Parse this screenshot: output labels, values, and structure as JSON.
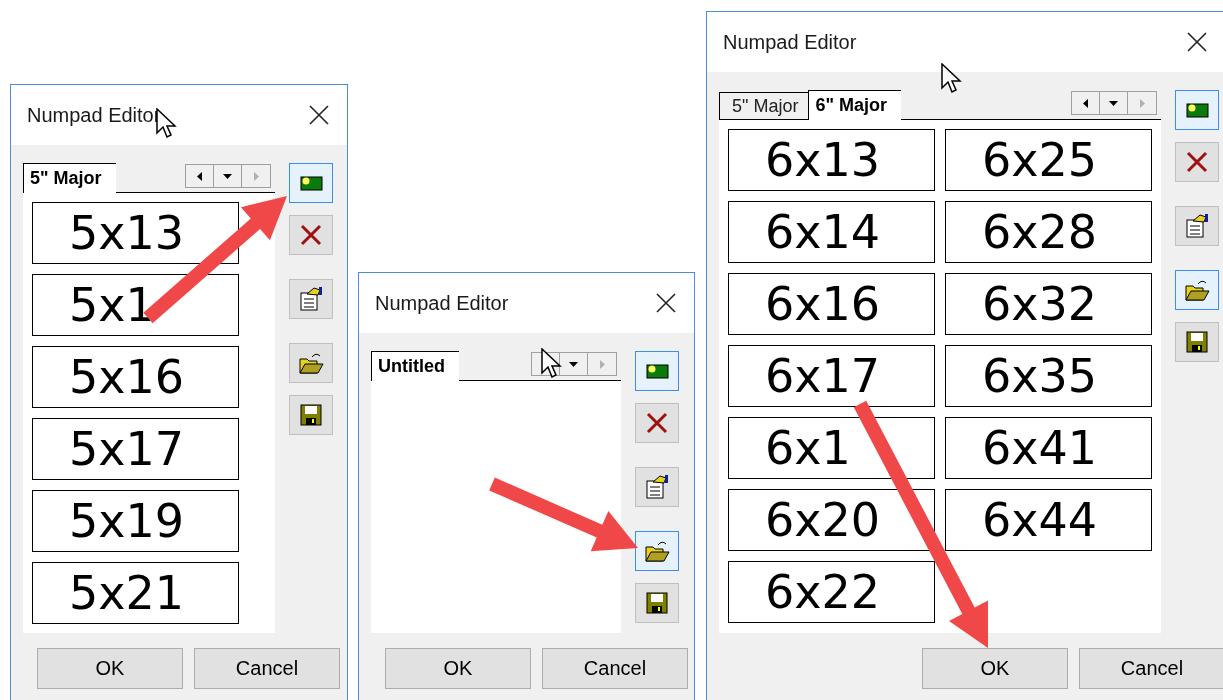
{
  "windows": [
    {
      "title": "Numpad Editor",
      "tabs": [
        {
          "label": "5\" Major",
          "selected": true
        }
      ],
      "keys": [
        "5x13",
        "5x1",
        "5x16",
        "5x17",
        "5x19",
        "5x21"
      ],
      "toolbar": [
        {
          "kind": "new",
          "highlighted": true
        },
        {
          "kind": "delete",
          "highlighted": false
        },
        {
          "kind": "properties",
          "highlighted": false
        },
        {
          "kind": "open",
          "highlighted": false
        },
        {
          "kind": "save",
          "highlighted": false
        }
      ],
      "buttons": [
        "OK",
        "Cancel"
      ]
    },
    {
      "title": "Numpad Editor",
      "tabs": [
        {
          "label": "Untitled",
          "selected": true
        }
      ],
      "toolbar": [
        {
          "kind": "new",
          "highlighted": true
        },
        {
          "kind": "delete",
          "highlighted": false
        },
        {
          "kind": "properties",
          "highlighted": false
        },
        {
          "kind": "open",
          "highlighted": true
        },
        {
          "kind": "save",
          "highlighted": false
        }
      ],
      "buttons": [
        "OK",
        "Cancel"
      ]
    },
    {
      "title": "Numpad Editor",
      "tabs": [
        {
          "label": "5\" Major",
          "selected": false
        },
        {
          "label": "6\" Major",
          "selected": true
        }
      ],
      "keys": [
        "6x13",
        "6x14",
        "6x16",
        "6x17",
        "6x1",
        "6x20",
        "6x22",
        "6x25",
        "6x28",
        "6x32",
        "6x35",
        "6x41",
        "6x44"
      ],
      "toolbar": [
        {
          "kind": "new",
          "highlighted": true
        },
        {
          "kind": "delete",
          "highlighted": false
        },
        {
          "kind": "properties",
          "highlighted": false
        },
        {
          "kind": "open",
          "highlighted": true
        },
        {
          "kind": "save",
          "highlighted": false
        }
      ],
      "buttons": [
        "OK",
        "Cancel"
      ]
    }
  ]
}
